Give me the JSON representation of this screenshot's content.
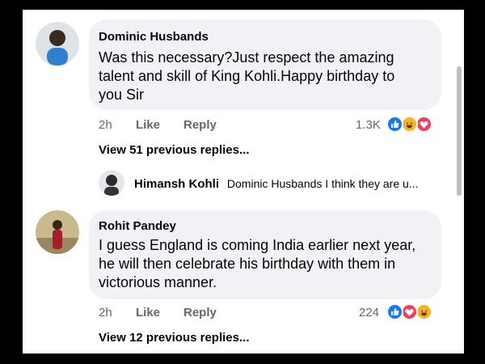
{
  "comments": [
    {
      "author": "Dominic Husbands",
      "lines": [
        "Was this necessary?Just respect the amazing",
        "talent and skill of King Kohli.Happy birthday to",
        "you Sir"
      ],
      "time": "2h",
      "like_label": "Like",
      "reply_label": "Reply",
      "reaction_count": "1.3K",
      "reaction_icons": [
        "like-icon",
        "haha-icon",
        "love-icon"
      ],
      "view_replies": "View 51 previous replies...",
      "reply": {
        "author": "Himansh Kohli",
        "text": "Dominic Husbands I think they are u..."
      }
    },
    {
      "author": "Rohit Pandey",
      "lines": [
        "I guess England is coming India earlier next year,",
        "he will then celebrate his birthday with them in",
        "victorious manner."
      ],
      "time": "2h",
      "like_label": "Like",
      "reply_label": "Reply",
      "reaction_count": "224",
      "reaction_icons": [
        "like-icon",
        "love-icon",
        "haha-icon"
      ],
      "view_replies": "View 12 previous replies..."
    }
  ],
  "colors": {
    "like": "#1877f2",
    "love": "#f33e58",
    "haha": "#f7b125",
    "bubble": "#f0f2f5",
    "meta_text": "#65676b"
  }
}
